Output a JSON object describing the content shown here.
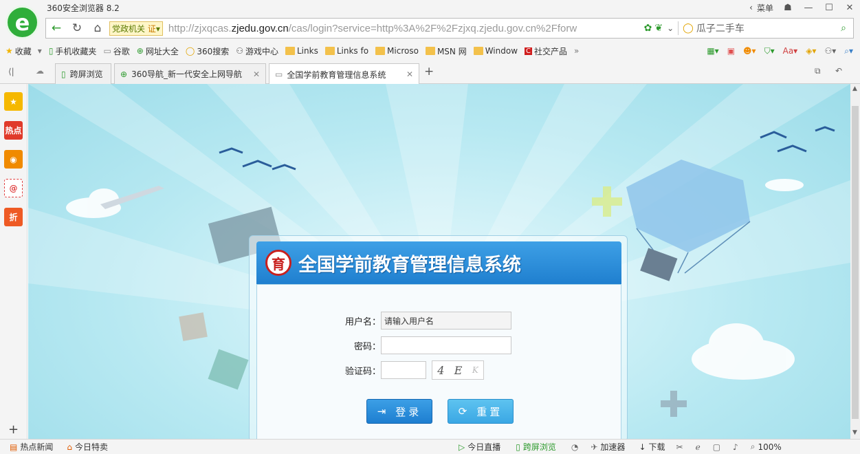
{
  "window": {
    "title": "360安全浏览器 8.2",
    "menu_label": "菜单"
  },
  "address_bar": {
    "gov_badge": "党政机关",
    "cert_badge": "证",
    "url_prefix": "http://zjxqcas.",
    "url_domain": "zjedu.gov.cn",
    "url_rest": "/cas/login?service=http%3A%2F%2Fzjxq.zjedu.gov.cn%2Fforw",
    "search_placeholder": "瓜子二手车"
  },
  "bookmarks": [
    {
      "label": "收藏",
      "icon": "star-icon"
    },
    {
      "label": "手机收藏夹",
      "icon": "phone-icon"
    },
    {
      "label": "谷歌",
      "icon": "page-icon"
    },
    {
      "label": "网址大全",
      "icon": "360-icon"
    },
    {
      "label": "360搜索",
      "icon": "search-icon"
    },
    {
      "label": "游戏中心",
      "icon": "gamepad-icon"
    },
    {
      "label": "Links",
      "icon": "folder-icon"
    },
    {
      "label": "Links fo",
      "icon": "folder-icon"
    },
    {
      "label": "Microso",
      "icon": "folder-icon"
    },
    {
      "label": "MSN 网",
      "icon": "folder-icon"
    },
    {
      "label": "Window",
      "icon": "folder-icon"
    },
    {
      "label": "社交产品",
      "icon": "social-icon"
    }
  ],
  "tabs": [
    {
      "label": "跨屏浏览"
    },
    {
      "label": "360导航_新一代安全上网导航"
    },
    {
      "label": "全国学前教育管理信息系统"
    }
  ],
  "sidebar": [
    "热点",
    "折"
  ],
  "login": {
    "title": "全国学前教育管理信息系统",
    "emblem_char": "育",
    "username_label": "用户名：",
    "username_placeholder": "请输入用户名",
    "password_label": "密码：",
    "captcha_label": "验证码：",
    "captcha_chars": [
      "4",
      "E",
      "K"
    ],
    "login_button": "登录",
    "reset_button": "重置"
  },
  "statusbar": {
    "hot_news": "热点新闻",
    "today_sale": "今日特卖",
    "live_today": "今日直播",
    "cross_screen": "跨屏浏览",
    "accelerator": "加速器",
    "download": "下载",
    "zoom": "100%"
  },
  "colors": {
    "brand_green": "#2fae3a",
    "header_blue": "#1f7fcf",
    "button_blue": "#2b8ee0"
  }
}
